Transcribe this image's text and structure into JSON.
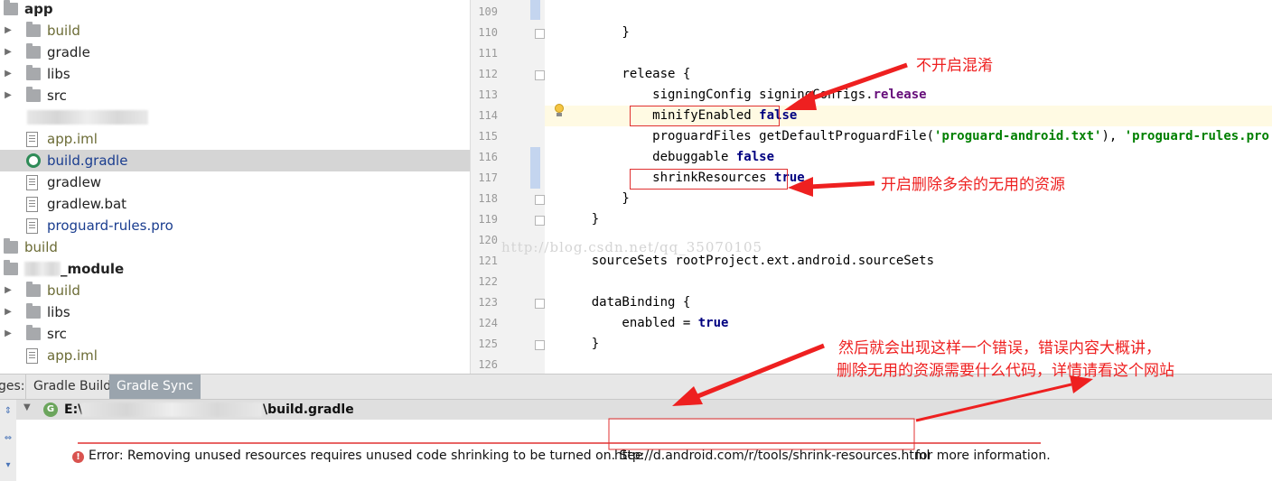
{
  "tree": {
    "items": [
      {
        "label": "app",
        "depth": 0,
        "type": "module",
        "arrow": "",
        "bold": true,
        "color": "#222222"
      },
      {
        "label": "build",
        "depth": 1,
        "type": "folder",
        "arrow": "▶",
        "color": "#6b6b35"
      },
      {
        "label": "gradle",
        "depth": 1,
        "type": "folder",
        "arrow": "▶",
        "color": "#222222"
      },
      {
        "label": "libs",
        "depth": 1,
        "type": "folder",
        "arrow": "▶",
        "color": "#222222"
      },
      {
        "label": "src",
        "depth": 1,
        "type": "folder",
        "arrow": "▶",
        "color": "#222222"
      },
      {
        "label": "",
        "depth": 1,
        "type": "blurred",
        "arrow": "",
        "color": "#222222"
      },
      {
        "label": "app.iml",
        "depth": 1,
        "type": "file",
        "arrow": "",
        "color": "#6b6b35"
      },
      {
        "label": "build.gradle",
        "depth": 1,
        "type": "gradle",
        "arrow": "",
        "color": "#1a3d8f",
        "selected": true
      },
      {
        "label": "gradlew",
        "depth": 1,
        "type": "file",
        "arrow": "",
        "color": "#222222"
      },
      {
        "label": "gradlew.bat",
        "depth": 1,
        "type": "file",
        "arrow": "",
        "color": "#222222"
      },
      {
        "label": "proguard-rules.pro",
        "depth": 1,
        "type": "file",
        "arrow": "",
        "color": "#1a3d8f"
      },
      {
        "label": "build",
        "depth": 0,
        "type": "folder",
        "arrow": "",
        "color": "#6b6b35"
      },
      {
        "label": "_module",
        "depth": 0,
        "type": "module",
        "arrow": "",
        "bold": true,
        "color": "#222222",
        "blurred_prefix": true
      },
      {
        "label": "build",
        "depth": 1,
        "type": "folder",
        "arrow": "▶",
        "color": "#6b6b35"
      },
      {
        "label": "libs",
        "depth": 1,
        "type": "folder",
        "arrow": "▶",
        "color": "#222222"
      },
      {
        "label": "src",
        "depth": 1,
        "type": "folder",
        "arrow": "▶",
        "color": "#222222"
      },
      {
        "label": "app.iml",
        "depth": 1,
        "type": "file",
        "arrow": "",
        "color": "#6b6b35"
      }
    ]
  },
  "editor": {
    "lines": [
      {
        "n": "109",
        "text": [
          {
            "t": ""
          }
        ]
      },
      {
        "n": "110",
        "text": [
          {
            "t": "        }"
          }
        ]
      },
      {
        "n": "111",
        "text": [
          {
            "t": ""
          }
        ]
      },
      {
        "n": "112",
        "text": [
          {
            "t": "        release {"
          }
        ]
      },
      {
        "n": "113",
        "text": [
          {
            "t": "            signingConfig signingConfigs."
          },
          {
            "t": "release",
            "c": "fld"
          }
        ]
      },
      {
        "n": "114",
        "text": [
          {
            "t": "            minifyEnabled "
          },
          {
            "t": "false",
            "c": "kw"
          }
        ]
      },
      {
        "n": "115",
        "text": [
          {
            "t": "            proguardFiles getDefaultProguardFile("
          },
          {
            "t": "'proguard-android.txt'",
            "c": "str"
          },
          {
            "t": "), "
          },
          {
            "t": "'proguard-rules.pro'",
            "c": "str"
          }
        ]
      },
      {
        "n": "116",
        "text": [
          {
            "t": "            debuggable "
          },
          {
            "t": "false",
            "c": "kw"
          }
        ]
      },
      {
        "n": "117",
        "text": [
          {
            "t": "            shrinkResources "
          },
          {
            "t": "true",
            "c": "kw"
          }
        ]
      },
      {
        "n": "118",
        "text": [
          {
            "t": "        }"
          }
        ]
      },
      {
        "n": "119",
        "text": [
          {
            "t": "    }"
          }
        ]
      },
      {
        "n": "120",
        "text": [
          {
            "t": ""
          }
        ]
      },
      {
        "n": "121",
        "text": [
          {
            "t": "    sourceSets rootProject.ext.android.sourceSets"
          }
        ]
      },
      {
        "n": "122",
        "text": [
          {
            "t": ""
          }
        ]
      },
      {
        "n": "123",
        "text": [
          {
            "t": "    dataBinding {"
          }
        ]
      },
      {
        "n": "124",
        "text": [
          {
            "t": "        enabled = "
          },
          {
            "t": "true",
            "c": "kw"
          }
        ]
      },
      {
        "n": "125",
        "text": [
          {
            "t": "    }"
          }
        ]
      },
      {
        "n": "126",
        "text": [
          {
            "t": ""
          }
        ]
      }
    ],
    "watermark": "http://blog.csdn.net/qq_35070105"
  },
  "bottom": {
    "tab_prefix": "ges:",
    "tabs": [
      {
        "label": "Gradle Build",
        "active": false
      },
      {
        "label": "Gradle Sync",
        "active": true
      }
    ],
    "file_badge": "G",
    "file_path_prefix": "E:\\",
    "file_path_suffix": "\\build.gradle",
    "error_icon": "!",
    "error_text": "Error: Removing unused resources requires unused code shrinking to be turned on. See",
    "error_link": "http://d.android.com/r/tools/shrink-resources.html",
    "error_suffix": "for more information."
  },
  "annotations": {
    "note_minify": "不开启混淆",
    "note_shrink": "开启删除多余的无用的资源",
    "note_error_line1": "然后就会出现这样一个错误，错误内容大概讲，",
    "note_error_line2": "删除无用的资源需要什么代码，详情请看这个网站"
  },
  "colors": {
    "annotation_red": "#ee2020",
    "keyword": "#000080",
    "string": "#008000",
    "field": "#660e7a",
    "selection": "#d5d5d5"
  }
}
